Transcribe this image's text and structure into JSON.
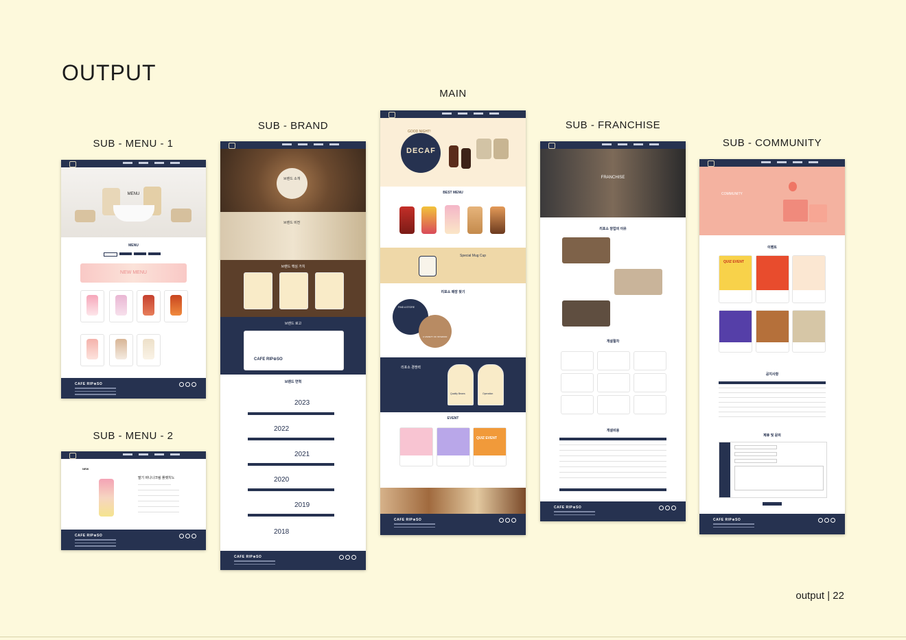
{
  "page": {
    "title": "OUTPUT",
    "footer": "output | 22"
  },
  "labels": {
    "menu1": "SUB - MENU - 1",
    "menu2": "SUB - MENU - 2",
    "brand": "SUB - BRAND",
    "main": "MAIN",
    "franchise": "SUB - FRANCHISE",
    "community": "SUB - COMMUNITY"
  },
  "site": {
    "brand": "CAFE RIP⊕SO",
    "brand_logo": "CAFE RIP⊕SO"
  },
  "menu1": {
    "hero": "MENU",
    "section": "MENU",
    "banner": "NEW MENU"
  },
  "menu2": {
    "badge": "NEW",
    "product": "딸기 바나나크림 플랫치노"
  },
  "brand": {
    "intro": "브랜드 소개",
    "vision": "브랜드 비전",
    "values": "브랜드 핵심 가치",
    "logo": "브랜드 로고",
    "history": "브랜드 연혁",
    "years": [
      "2023",
      "2022",
      "2021",
      "2020",
      "2019",
      "2018"
    ]
  },
  "main": {
    "hero_small": "GOOD NIGHT!",
    "hero_big": "DECAF",
    "best": "BEST MENU",
    "mug": "Special Mug Cup",
    "find": "리포소 매장 찾기",
    "find_label": "FIND A STORE",
    "find_sub": "A VARIETY OF INTERIOR",
    "strength": "리포소 경쟁력",
    "quality": "Quality Beans",
    "operation": "Operation",
    "event": "EVENT",
    "quiz": "QUIZ EVENT"
  },
  "franchise": {
    "hero": "FRANCHISE",
    "reason": "리포소 창업의 이유",
    "process": "개설절차",
    "cost": "개설비용"
  },
  "community": {
    "hero": "COMMUNITY",
    "event": "이벤트",
    "quiz": "QUIZ EVENT",
    "notice": "공지사항",
    "inquiry": "제휴 및 문의"
  },
  "colors": {
    "navy": "#263250",
    "background": "#fdf9dc",
    "pink": "#f6b9a6",
    "cream": "#f5e6c6"
  }
}
